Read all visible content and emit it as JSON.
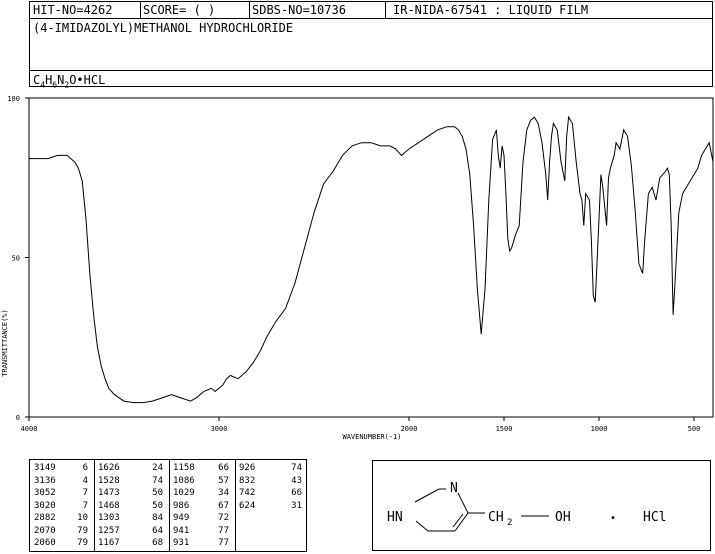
{
  "header": {
    "hit_no": "HIT-NO=4262",
    "score": "SCORE=  (   )",
    "sdbs_no": "SDBS-NO=10736",
    "ir_id": "IR-NIDA-67541 : LIQUID FILM",
    "compound_name": "(4-IMIDAZOLYL)METHANOL HYDROCHLORIDE",
    "formula_parts": [
      "C",
      "4",
      "H",
      "6",
      "N",
      "2",
      "O",
      "•HCL"
    ]
  },
  "chart_data": {
    "type": "line",
    "xlabel": "WAVENUMBER(-1)",
    "ylabel": "TRANSMITTANCE(%)",
    "xlim": [
      4000,
      400
    ],
    "ylim": [
      0,
      100
    ],
    "x_ticks": [
      4000,
      3000,
      2000,
      1500,
      1000,
      500
    ],
    "y_ticks": [
      0,
      50,
      100
    ],
    "grid": false,
    "series": [
      {
        "x": [
          4000,
          3900,
          3850,
          3800,
          3780,
          3760,
          3740,
          3720,
          3700,
          3680,
          3660,
          3640,
          3620,
          3600,
          3580,
          3550,
          3500,
          3450,
          3400,
          3350,
          3300,
          3250,
          3200,
          3150,
          3120,
          3080,
          3040,
          3020,
          2980,
          2960,
          2940,
          2900,
          2860,
          2820,
          2780,
          2750,
          2700,
          2650,
          2600,
          2550,
          2500,
          2450,
          2400,
          2350,
          2300,
          2250,
          2200,
          2150,
          2100,
          2070,
          2040,
          2000,
          1950,
          1900,
          1850,
          1800,
          1760,
          1740,
          1720,
          1700,
          1680,
          1660,
          1640,
          1620,
          1600,
          1580,
          1560,
          1540,
          1530,
          1520,
          1510,
          1500,
          1490,
          1480,
          1470,
          1460,
          1440,
          1420,
          1400,
          1380,
          1360,
          1340,
          1320,
          1300,
          1280,
          1270,
          1260,
          1250,
          1240,
          1220,
          1200,
          1180,
          1170,
          1160,
          1140,
          1120,
          1100,
          1090,
          1080,
          1070,
          1050,
          1040,
          1030,
          1020,
          1000,
          990,
          980,
          960,
          950,
          940,
          930,
          920,
          910,
          890,
          870,
          850,
          830,
          810,
          790,
          770,
          760,
          740,
          720,
          700,
          680,
          650,
          640,
          630,
          620,
          610,
          600,
          580,
          560,
          540,
          520,
          500,
          480,
          460,
          440,
          420,
          400
        ],
        "y": [
          81,
          81,
          82,
          82,
          81,
          80,
          78,
          74,
          62,
          45,
          32,
          22,
          16,
          12,
          9,
          7,
          5,
          4.5,
          4.5,
          5,
          6,
          7,
          6,
          5,
          6,
          8,
          9,
          8,
          10,
          12,
          13,
          12,
          14,
          17,
          21,
          25,
          30,
          34,
          42,
          53,
          64,
          73,
          77,
          82,
          85,
          86,
          86,
          85,
          85,
          84,
          82,
          84,
          86,
          88,
          90,
          91,
          91,
          90,
          88,
          84,
          76,
          60,
          40,
          26,
          40,
          68,
          87,
          90,
          82,
          78,
          85,
          82,
          70,
          56,
          52,
          53,
          57,
          60,
          80,
          90,
          93,
          94,
          92,
          86,
          76,
          68,
          80,
          88,
          92,
          90,
          80,
          74,
          88,
          94,
          92,
          80,
          70,
          68,
          60,
          70,
          68,
          55,
          38,
          36,
          62,
          76,
          72,
          60,
          75,
          78,
          80,
          82,
          86,
          84,
          90,
          88,
          79,
          65,
          48,
          45,
          55,
          70,
          72,
          68,
          75,
          77,
          78,
          76,
          60,
          32,
          42,
          64,
          70,
          72,
          74,
          76,
          78,
          82,
          84,
          86,
          80
        ]
      }
    ]
  },
  "peaks": {
    "columns": [
      [
        [
          "3149",
          "6"
        ],
        [
          "3136",
          "4"
        ],
        [
          "3052",
          "7"
        ],
        [
          "3020",
          "7"
        ],
        [
          "2882",
          "10"
        ],
        [
          "2070",
          "79"
        ],
        [
          "2060",
          "79"
        ]
      ],
      [
        [
          "1626",
          "24"
        ],
        [
          "1528",
          "74"
        ],
        [
          "1473",
          "50"
        ],
        [
          "1468",
          "50"
        ],
        [
          "1303",
          "84"
        ],
        [
          "1257",
          "64"
        ],
        [
          "1167",
          "68"
        ]
      ],
      [
        [
          "1158",
          "66"
        ],
        [
          "1086",
          "57"
        ],
        [
          "1029",
          "34"
        ],
        [
          "986",
          "67"
        ],
        [
          "949",
          "72"
        ],
        [
          "941",
          "77"
        ],
        [
          "931",
          "77"
        ]
      ],
      [
        [
          "926",
          "74"
        ],
        [
          "832",
          "43"
        ],
        [
          "742",
          "66"
        ],
        [
          "624",
          "31"
        ]
      ]
    ]
  },
  "structure": {
    "ring_n_top": "N",
    "ring_nh": "HN",
    "ch2": "CH",
    "ch2_sub": "2",
    "oh": "OH",
    "dot": "•",
    "hcl": "HCl"
  }
}
